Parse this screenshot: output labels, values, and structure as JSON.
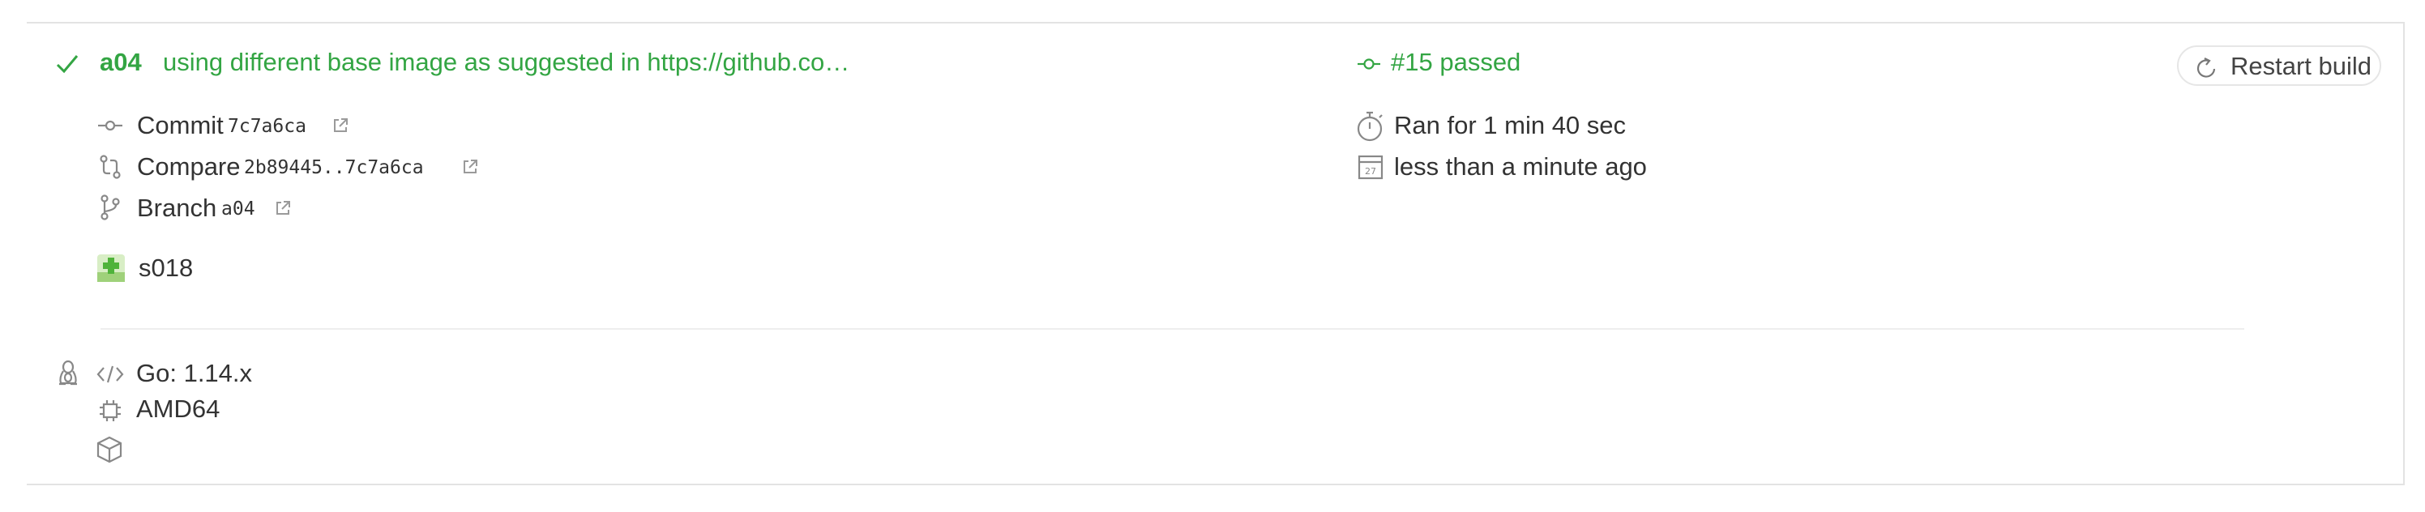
{
  "build": {
    "branch_name": "a04",
    "commit_message": "using different base image as suggested in https://github.co…",
    "status_text": "#15 passed",
    "status_color": "#3aa844"
  },
  "details": {
    "commit_label": "Commit",
    "commit_value": "7c7a6ca",
    "compare_label": "Compare",
    "compare_value": "2b89445..7c7a6ca",
    "branch_label": "Branch",
    "branch_value": "a04",
    "author": "s018"
  },
  "timing": {
    "duration": "Ran for 1 min 40 sec",
    "finished": "less than a minute ago",
    "calendar_day": "27"
  },
  "actions": {
    "restart_label": "Restart build"
  },
  "config": {
    "language": "Go: 1.14.x",
    "arch": "AMD64"
  },
  "icons": {
    "status": "check-icon",
    "commit": "commit-icon",
    "compare": "compare-icon",
    "branch": "branch-icon",
    "stopwatch": "stopwatch-icon",
    "calendar": "calendar-icon",
    "os": "linux-icon",
    "code": "code-icon",
    "cpu": "cpu-icon",
    "box": "box-icon",
    "restart": "restart-icon"
  }
}
